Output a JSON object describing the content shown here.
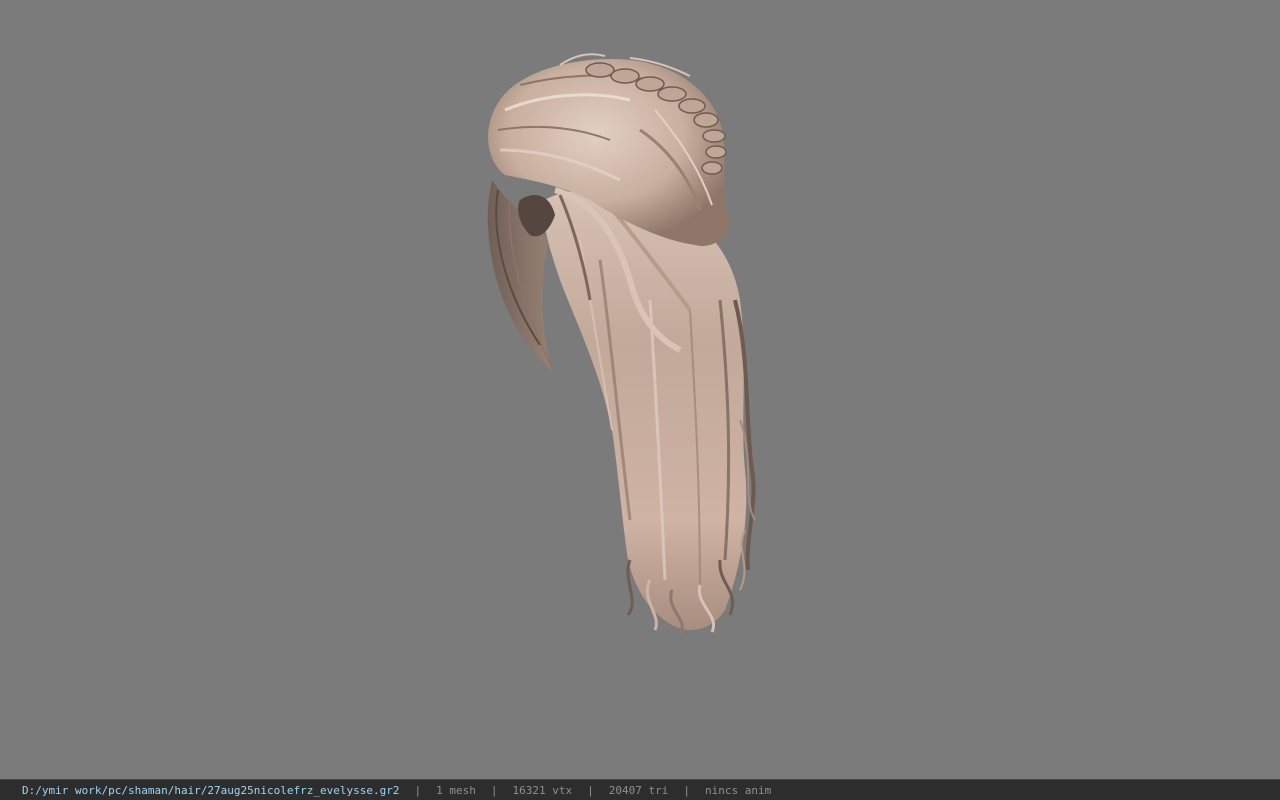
{
  "viewport": {
    "background_color": "#7b7b7b",
    "model": {
      "subject": "long wavy hair with braided bun",
      "hair_color_light": "#d9c3b6",
      "hair_color_mid": "#b59a8a",
      "hair_color_shadow": "#6f5c52"
    }
  },
  "status_bar": {
    "file_path": "D:/ymir work/pc/shaman/hair/27aug25nicolefrz_evelysse.gr2",
    "separator": "|",
    "mesh_count": "1 mesh",
    "vertex_count": "16321 vtx",
    "triangle_count": "20407 tri",
    "anim_status": "nincs anim",
    "path_color": "#9fd4f2",
    "text_color": "#8f8f8f",
    "background_color": "#2d2d2d"
  }
}
